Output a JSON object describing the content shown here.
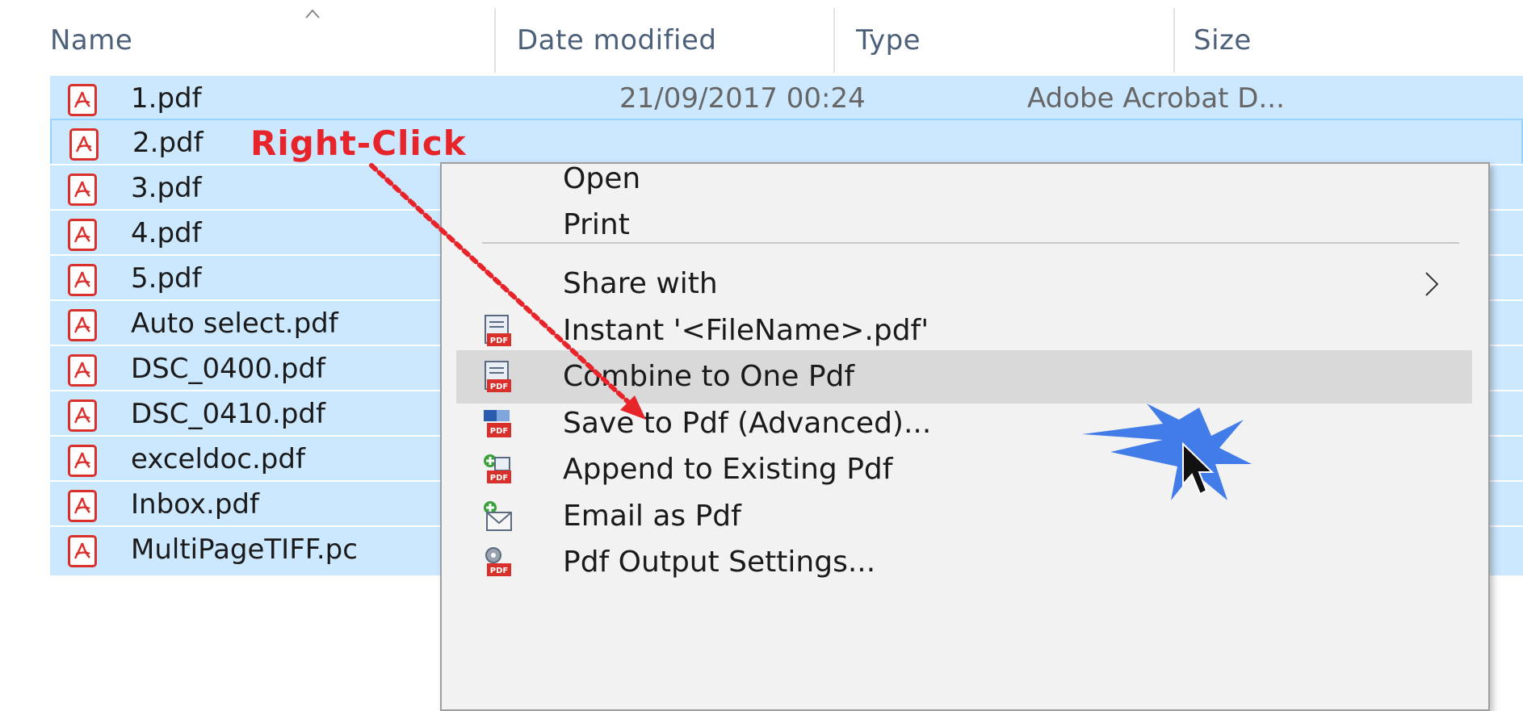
{
  "columns": {
    "name": "Name",
    "date_modified": "Date modified",
    "type": "Type",
    "size": "Size"
  },
  "sort_indicator": "caret-up-icon",
  "files": [
    {
      "name": "1.pdf",
      "date": "21/09/2017 00:24",
      "type": "Adobe Acrobat D..."
    },
    {
      "name": "2.pdf",
      "date": "",
      "type": ""
    },
    {
      "name": "3.pdf",
      "date": "",
      "type": ""
    },
    {
      "name": "4.pdf",
      "date": "",
      "type": ""
    },
    {
      "name": "5.pdf",
      "date": "",
      "type": ""
    },
    {
      "name": "Auto select.pdf",
      "date": "",
      "type": ""
    },
    {
      "name": "DSC_0400.pdf",
      "date": "",
      "type": ""
    },
    {
      "name": "DSC_0410.pdf",
      "date": "",
      "type": ""
    },
    {
      "name": "exceldoc.pdf",
      "date": "",
      "type": ""
    },
    {
      "name": "Inbox.pdf",
      "date": "",
      "type": ""
    },
    {
      "name": "MultiPageTIFF.pc",
      "date": "",
      "type": ""
    }
  ],
  "context_menu": {
    "items": [
      {
        "label": "Open"
      },
      {
        "label": "Print"
      },
      {
        "label": "Share with",
        "submenu_icon": "chevron-right-icon"
      },
      {
        "label": "Instant '<FileName>.pdf'",
        "icon": "pdf-document-icon"
      },
      {
        "label": "Combine to One Pdf",
        "icon": "pdf-document-icon",
        "highlighted": true
      },
      {
        "label": "Save to Pdf (Advanced)...",
        "icon": "pdf-advanced-icon"
      },
      {
        "label": "Append to Existing Pdf",
        "icon": "pdf-append-icon"
      },
      {
        "label": "Email as Pdf",
        "icon": "email-icon"
      },
      {
        "label": "Pdf Output Settings...",
        "icon": "pdf-settings-icon"
      }
    ]
  },
  "annotation": {
    "label": "Right-Click",
    "color": "#e8242b"
  },
  "colors": {
    "selection": "#cce8ff",
    "menu_background": "#f2f2f2",
    "menu_highlight": "#d9d9d9",
    "pdf_red": "#d9302c",
    "burst_blue": "#2f6fe8"
  }
}
